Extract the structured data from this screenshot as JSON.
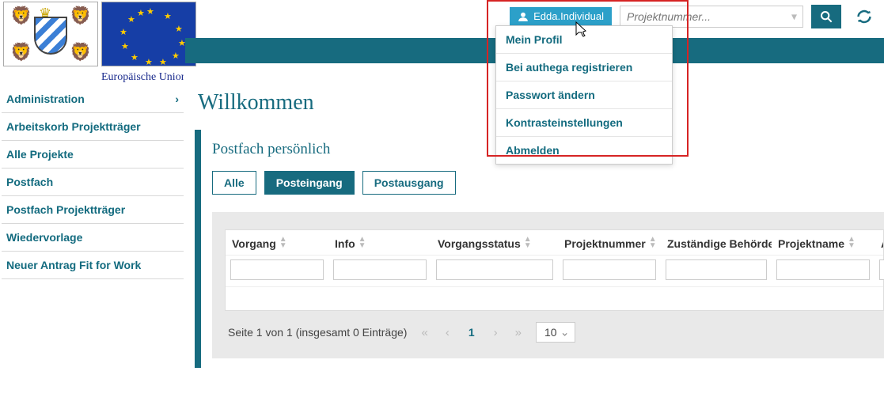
{
  "header": {
    "eu_caption": "Europäische Union",
    "user_label": "Edda.Individual",
    "search_placeholder": "Projektnummer...",
    "user_menu": [
      "Mein Profil",
      "Bei authega registrieren",
      "Passwort ändern",
      "Kontrasteinstellungen",
      "Abmelden"
    ]
  },
  "sidebar": {
    "items": [
      {
        "label": "Administration",
        "has_children": true
      },
      {
        "label": "Arbeitskorb Projektträger",
        "has_children": false
      },
      {
        "label": "Alle Projekte",
        "has_children": false
      },
      {
        "label": "Postfach",
        "has_children": false
      },
      {
        "label": "Postfach Projektträger",
        "has_children": false
      },
      {
        "label": "Wiedervorlage",
        "has_children": false
      },
      {
        "label": "Neuer Antrag Fit for Work",
        "has_children": false
      }
    ]
  },
  "main": {
    "page_title": "Willkommen",
    "panel_title": "Postfach persönlich",
    "filters": {
      "all": "Alle",
      "inbox": "Posteingang",
      "outbox": "Postausgang",
      "active": "inbox"
    },
    "columns": [
      "Vorgang",
      "Info",
      "Vorgangsstatus",
      "Projektnummer",
      "Zuständige Behörde",
      "Projektname",
      "Absender"
    ],
    "pager": {
      "summary": "Seite 1 von 1 (insgesamt 0 Einträge)",
      "current_page": "1",
      "page_size": "10"
    }
  },
  "colors": {
    "teal": "#176b7f",
    "cyan_button": "#2ca0c9",
    "red_highlight": "#d62424",
    "eu_blue": "#1a2b8d"
  }
}
